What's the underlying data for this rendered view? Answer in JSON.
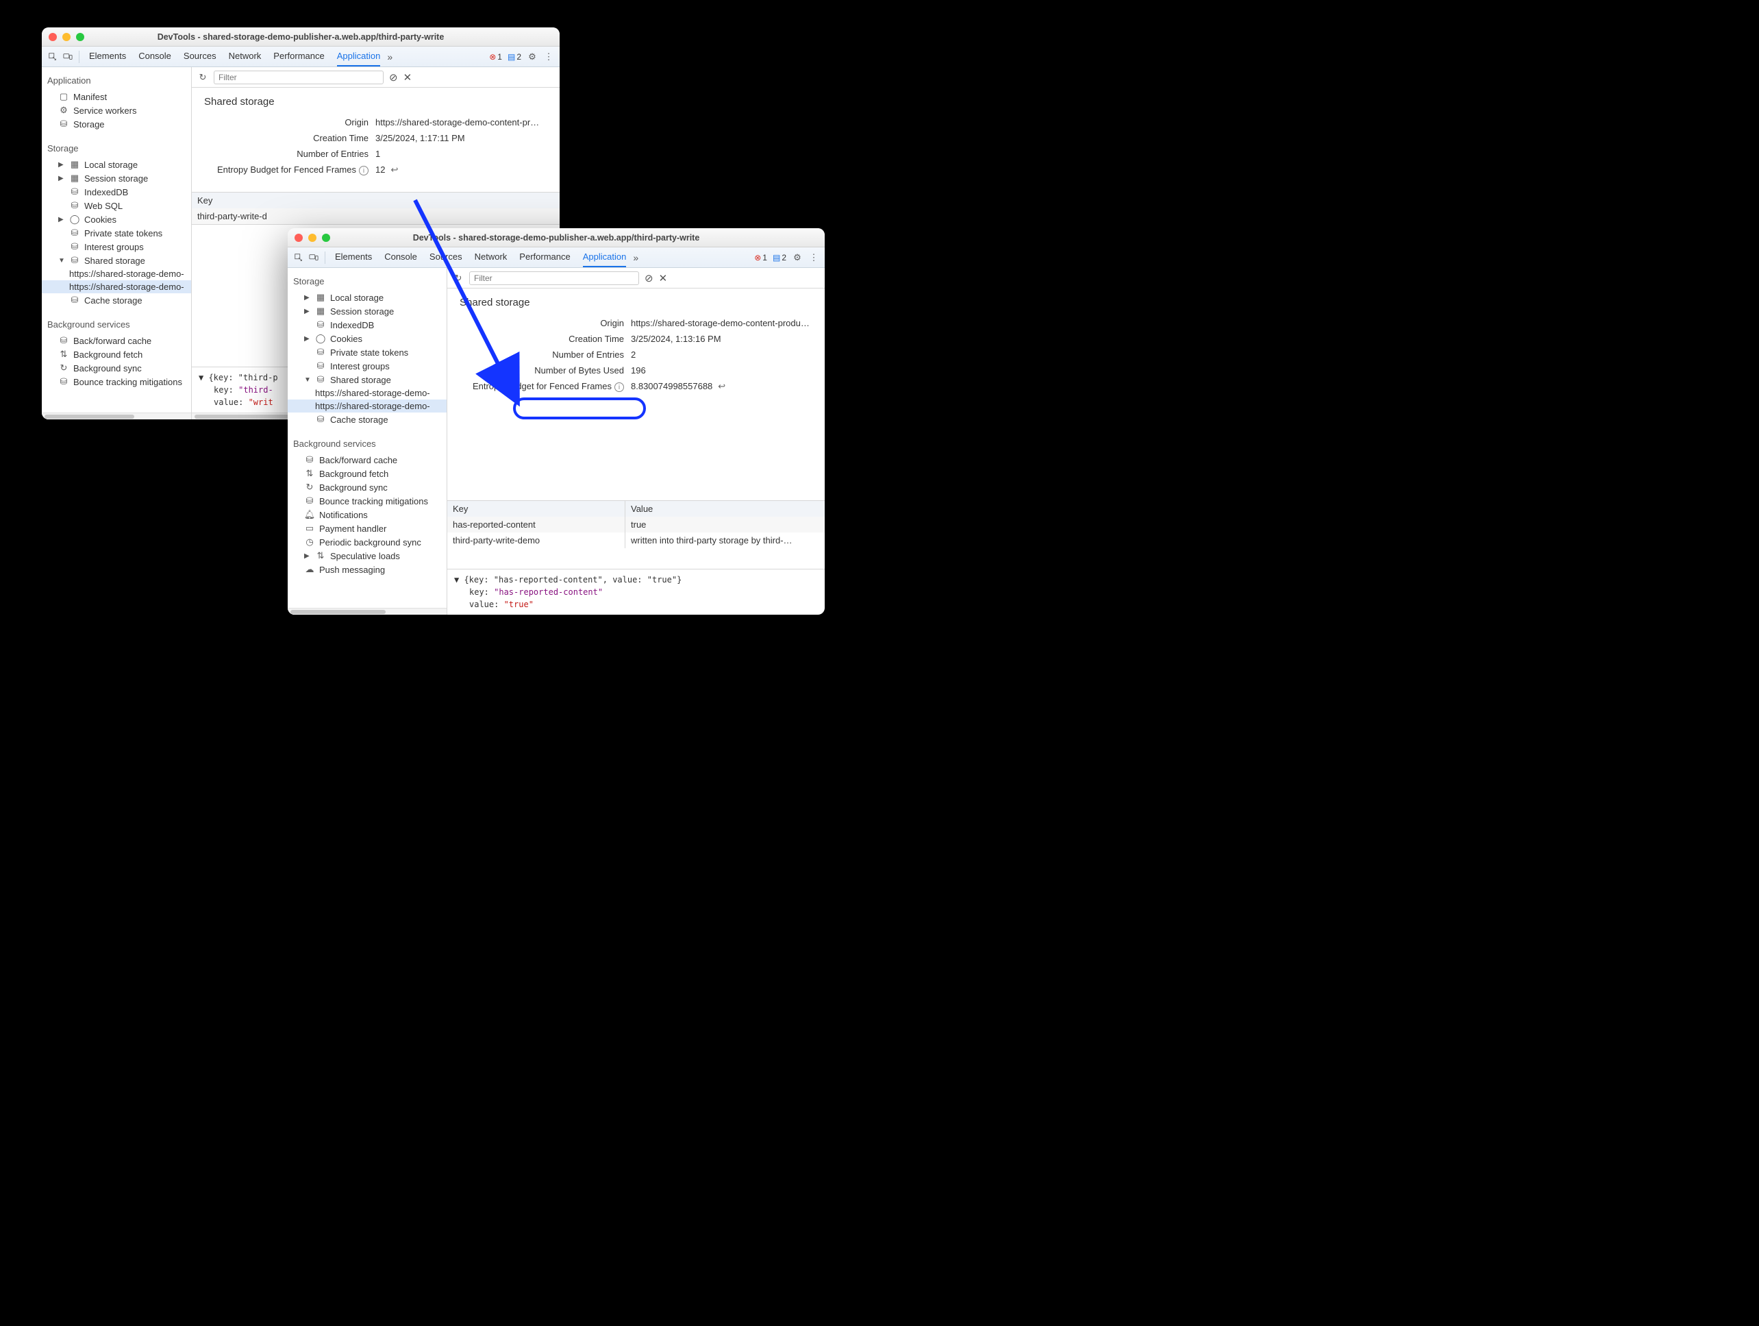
{
  "winA": {
    "title": "DevTools - shared-storage-demo-publisher-a.web.app/third-party-write",
    "tabs": [
      "Elements",
      "Console",
      "Sources",
      "Network",
      "Performance",
      "Application"
    ],
    "activeTab": "Application",
    "errCount": "1",
    "msgCount": "2",
    "filterPlaceholder": "Filter",
    "sidebar": {
      "secApp": "Application",
      "appItems": [
        "Manifest",
        "Service workers",
        "Storage"
      ],
      "secStorage": "Storage",
      "local": "Local storage",
      "session": "Session storage",
      "indexed": "IndexedDB",
      "websql": "Web SQL",
      "cookies": "Cookies",
      "pst": "Private state tokens",
      "ig": "Interest groups",
      "shared": "Shared storage",
      "sharedChild1": "https://shared-storage-demo-",
      "sharedChild2": "https://shared-storage-demo-",
      "cache": "Cache storage",
      "secBg": "Background services",
      "bfc": "Back/forward cache",
      "bgf": "Background fetch",
      "bgs": "Background sync",
      "btm": "Bounce tracking mitigations"
    },
    "panel": {
      "title": "Shared storage",
      "origin_k": "Origin",
      "origin_v": "https://shared-storage-demo-content-pr…",
      "creation_k": "Creation Time",
      "creation_v": "3/25/2024, 1:17:11 PM",
      "entries_k": "Number of Entries",
      "entries_v": "1",
      "entropy_k": "Entropy Budget for Fenced Frames",
      "entropy_v": "12",
      "keyHdr": "Key",
      "row1": "third-party-write-d",
      "json_l1_pre": "▼ {key: \"third-p",
      "json_l2_k": "key: ",
      "json_l2_v": "\"third-",
      "json_l3_k": "value: ",
      "json_l3_v": "\"writ"
    }
  },
  "winB": {
    "title": "DevTools - shared-storage-demo-publisher-a.web.app/third-party-write",
    "tabs": [
      "Elements",
      "Console",
      "Sources",
      "Network",
      "Performance",
      "Application"
    ],
    "activeTab": "Application",
    "errCount": "1",
    "msgCount": "2",
    "filterPlaceholder": "Filter",
    "sidebar": {
      "secStorage": "Storage",
      "local": "Local storage",
      "session": "Session storage",
      "indexed": "IndexedDB",
      "cookies": "Cookies",
      "pst": "Private state tokens",
      "ig": "Interest groups",
      "shared": "Shared storage",
      "sharedChild1": "https://shared-storage-demo-",
      "sharedChild2": "https://shared-storage-demo-",
      "cache": "Cache storage",
      "secBg": "Background services",
      "bfc": "Back/forward cache",
      "bgf": "Background fetch",
      "bgs": "Background sync",
      "btm": "Bounce tracking mitigations",
      "notif": "Notifications",
      "pay": "Payment handler",
      "pbs": "Periodic background sync",
      "spec": "Speculative loads",
      "push": "Push messaging"
    },
    "panel": {
      "title": "Shared storage",
      "origin_k": "Origin",
      "origin_v": "https://shared-storage-demo-content-produ…",
      "creation_k": "Creation Time",
      "creation_v": "3/25/2024, 1:13:16 PM",
      "entries_k": "Number of Entries",
      "entries_v": "2",
      "bytes_k": "Number of Bytes Used",
      "bytes_v": "196",
      "entropy_k": "Entropy Budget for Fenced Frames",
      "entropy_v": "8.830074998557688",
      "keyHdr": "Key",
      "valHdr": "Value",
      "r1k": "has-reported-content",
      "r1v": "true",
      "r2k": "third-party-write-demo",
      "r2v": "written into third-party storage by third-…",
      "json_l1": "▼ {key: \"has-reported-content\", value: \"true\"}",
      "json_l2_k": "key: ",
      "json_l2_v": "\"has-reported-content\"",
      "json_l3_k": "value: ",
      "json_l3_v": "\"true\""
    }
  }
}
